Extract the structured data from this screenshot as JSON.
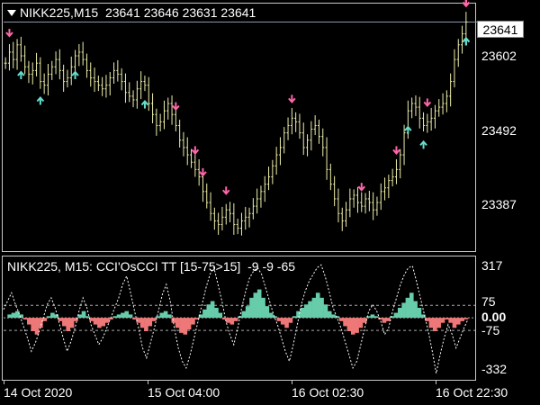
{
  "main_title": "NIKK225,M15  23641 23646 23631 23641",
  "osc_title": "NIKK225, M15: CCI'OsCCI TT [15-75>15]  -9 -9 -65",
  "price_box": "23641",
  "colors": {
    "background": "#000000",
    "candle": "#eeeeaa",
    "arrow_up": "#66ddcc",
    "arrow_down": "#ff66aa",
    "hist_pos": "#66ccaa",
    "hist_neg": "#ee7777",
    "cci_line": "#ffffff"
  },
  "chart_data": [
    {
      "type": "candlestick",
      "symbol": "NIKK225",
      "timeframe": "M15",
      "ohlc_last": {
        "open": 23641,
        "high": 23646,
        "low": 23631,
        "close": 23641
      },
      "y_tick_labels": [
        "23602",
        "23492",
        "23387"
      ],
      "y_ticks": [
        23602,
        23492,
        23387
      ],
      "ylim": [
        23330,
        23665
      ],
      "close_series": [
        23585,
        23600,
        23590,
        23610,
        23595,
        23580,
        23570,
        23575,
        23585,
        23560,
        23555,
        23570,
        23580,
        23590,
        23575,
        23560,
        23565,
        23580,
        23595,
        23600,
        23590,
        23575,
        23565,
        23560,
        23555,
        23550,
        23555,
        23565,
        23575,
        23570,
        23560,
        23545,
        23540,
        23535,
        23550,
        23560,
        23555,
        23530,
        23515,
        23500,
        23505,
        23520,
        23530,
        23515,
        23500,
        23480,
        23470,
        23460,
        23450,
        23440,
        23430,
        23410,
        23395,
        23380,
        23370,
        23365,
        23375,
        23385,
        23380,
        23365,
        23360,
        23370,
        23375,
        23380,
        23390,
        23400,
        23410,
        23420,
        23430,
        23445,
        23460,
        23470,
        23490,
        23500,
        23510,
        23505,
        23490,
        23470,
        23480,
        23495,
        23500,
        23485,
        23470,
        23440,
        23420,
        23400,
        23380,
        23370,
        23385,
        23400,
        23405,
        23395,
        23390,
        23400,
        23395,
        23385,
        23395,
        23410,
        23415,
        23425,
        23430,
        23440,
        23460,
        23490,
        23520,
        23530,
        23525,
        23510,
        23500,
        23505,
        23510,
        23520,
        23525,
        23530,
        23540,
        23560,
        23590,
        23610,
        23625,
        23641
      ],
      "arrows_up_index": [
        4,
        9,
        18,
        36,
        104,
        108,
        151,
        163,
        169
      ],
      "arrows_down_index": [
        1,
        44,
        49,
        51,
        57,
        74,
        92,
        101,
        109,
        132,
        138,
        152,
        156
      ],
      "x_tick_labels": [
        "14 Oct 2020",
        "15 Oct 04:00",
        "16 Oct 02:30",
        "16 Oct 22:30"
      ]
    },
    {
      "type": "bar+line",
      "name": "CCI'OsCCI TT [15-75>15]",
      "values_last": [
        -9,
        -9,
        -65
      ],
      "y_tick_labels": [
        "317",
        "75",
        "0.00",
        "-75",
        "-332"
      ],
      "y_ticks": [
        317,
        75,
        0,
        -75,
        -332
      ],
      "levels": [
        75,
        -75
      ],
      "ylim": [
        -360,
        340
      ],
      "histogram": [
        0,
        20,
        30,
        40,
        20,
        -10,
        -40,
        -80,
        -100,
        -60,
        -20,
        10,
        30,
        20,
        -20,
        -50,
        -80,
        -60,
        -20,
        20,
        40,
        10,
        -20,
        -40,
        -60,
        -50,
        -30,
        -10,
        10,
        20,
        30,
        40,
        20,
        -10,
        -30,
        -60,
        -80,
        -50,
        -20,
        10,
        30,
        40,
        20,
        -30,
        -60,
        -90,
        -100,
        -70,
        -40,
        -10,
        20,
        50,
        80,
        100,
        60,
        30,
        -10,
        -30,
        -40,
        -20,
        10,
        40,
        70,
        120,
        150,
        170,
        120,
        70,
        30,
        10,
        -20,
        -40,
        -60,
        -30,
        10,
        40,
        60,
        80,
        100,
        120,
        150,
        120,
        80,
        40,
        20,
        10,
        -20,
        -50,
        -80,
        -100,
        -90,
        -60,
        -30,
        10,
        20,
        10,
        -10,
        -30,
        -20,
        10,
        30,
        60,
        90,
        120,
        150,
        100,
        60,
        20,
        -20,
        -60,
        -80,
        -60,
        -30,
        -10,
        -30,
        -60,
        -40,
        -20,
        -9
      ],
      "cci_line": [
        50,
        100,
        150,
        80,
        20,
        -50,
        -120,
        -200,
        -150,
        -80,
        0,
        80,
        120,
        60,
        -30,
        -120,
        -200,
        -140,
        -60,
        40,
        120,
        60,
        -40,
        -100,
        -160,
        -120,
        -60,
        0,
        60,
        120,
        200,
        250,
        150,
        40,
        -60,
        -180,
        -240,
        -150,
        -60,
        40,
        140,
        200,
        100,
        -60,
        -180,
        -260,
        -300,
        -220,
        -120,
        -20,
        80,
        180,
        260,
        300,
        200,
        100,
        -20,
        -100,
        -160,
        -60,
        60,
        160,
        240,
        280,
        300,
        260,
        180,
        100,
        20,
        -40,
        -120,
        -200,
        -260,
        -160,
        -40,
        80,
        160,
        220,
        260,
        300,
        317,
        250,
        160,
        60,
        0,
        -60,
        -140,
        -220,
        -300,
        -260,
        -160,
        -60,
        40,
        80,
        40,
        -20,
        -100,
        -60,
        40,
        120,
        200,
        260,
        300,
        310,
        220,
        120,
        20,
        -80,
        -200,
        -332,
        -220,
        -120,
        -40,
        -100,
        -180,
        -120,
        -60,
        -9
      ]
    }
  ]
}
